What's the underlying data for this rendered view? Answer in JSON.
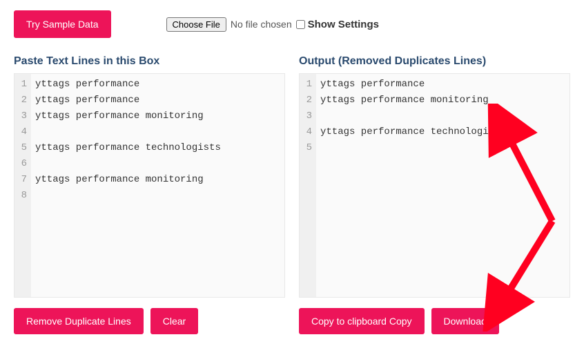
{
  "top": {
    "sample_button": "Try Sample Data",
    "choose_file": "Choose File",
    "no_file": "No file chosen",
    "show_settings": "Show Settings"
  },
  "left": {
    "header": "Paste Text Lines in this Box",
    "lines": [
      "yttags performance",
      "yttags performance",
      "yttags performance monitoring",
      "",
      "yttags performance technologists",
      "",
      "yttags performance monitoring",
      ""
    ],
    "btn_remove": "Remove Duplicate Lines",
    "btn_clear": "Clear"
  },
  "right": {
    "header": "Output (Removed Duplicates Lines)",
    "lines": [
      "yttags performance",
      "yttags performance monitoring",
      "",
      "yttags performance technologists",
      ""
    ],
    "btn_copy": "Copy to clipboard Copy",
    "btn_download": "Download"
  }
}
